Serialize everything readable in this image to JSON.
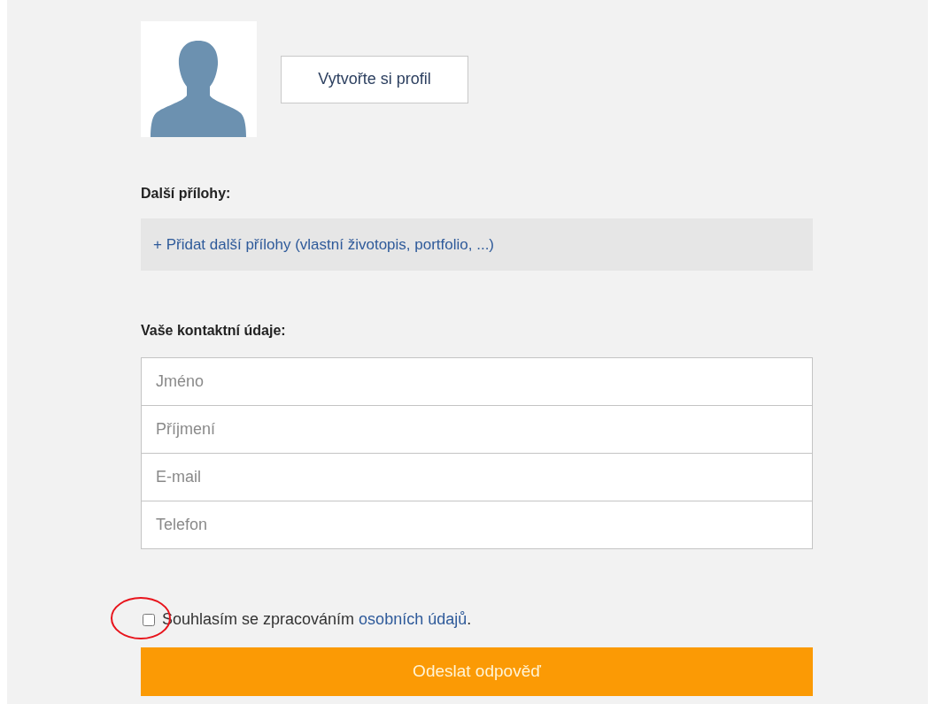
{
  "profile": {
    "button": "Vytvořte si profil"
  },
  "attachments": {
    "label": "Další přílohy:",
    "add_link": "+ Přidat další přílohy (vlastní životopis, portfolio, ...)"
  },
  "contact": {
    "label": "Vaše kontaktní údaje:",
    "fields": [
      {
        "placeholder": "Jméno"
      },
      {
        "placeholder": "Příjmení"
      },
      {
        "placeholder": "E-mail"
      },
      {
        "placeholder": "Telefon"
      }
    ]
  },
  "consent": {
    "checked": false,
    "text": "Souhlasím se zpracováním ",
    "link": "osobních údajů",
    "text_end": "."
  },
  "submit": "Odeslat odpověď"
}
